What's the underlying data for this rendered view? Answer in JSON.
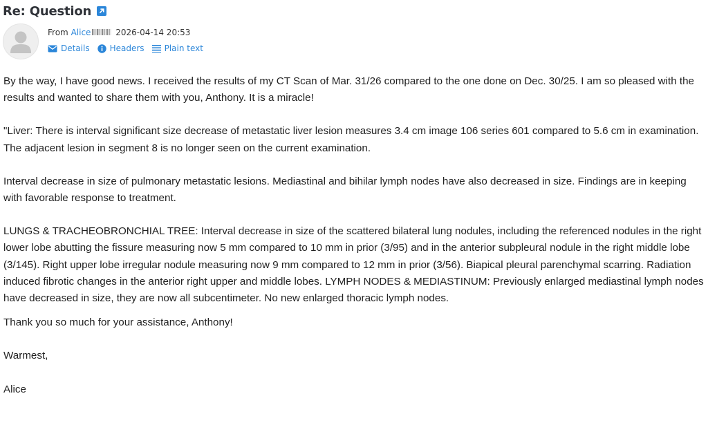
{
  "message": {
    "subject": "Re: Question",
    "from_label": "From",
    "sender_name": "Alice",
    "date": "2026-04-14 20:53",
    "links": {
      "details": "Details",
      "headers": "Headers",
      "plain_text": "Plain text"
    }
  },
  "body": {
    "paragraphs": [
      "By the way, I have good news. I received the results of my CT Scan of Mar. 31/26 compared to the one done on Dec. 30/25. I am so pleased with the results and wanted to share them with you, Anthony. It is a miracle!",
      "\"Liver: There is interval significant size decrease of metastatic liver lesion measures 3.4 cm image 106 series 601 compared to 5.6 cm in examination. The adjacent lesion in segment 8 is no longer seen on the current examination.",
      "Interval decrease in size of pulmonary metastatic lesions. Mediastinal and bihilar lymph nodes have also decreased in size. Findings are in keeping with favorable response to treatment.",
      "LUNGS & TRACHEOBRONCHIAL TREE: Interval decrease in size of the scattered bilateral lung nodules, including the referenced nodules in the right lower lobe abutting the fissure measuring now 5 mm compared to 10 mm in prior (3/95) and in the anterior subpleural nodule in the right middle lobe (3/145). Right upper lobe irregular nodule measuring now 9 mm compared to 12 mm in prior (3/56). Biapical pleural parenchymal scarring. Radiation induced fibrotic changes in the anterior right upper and middle lobes. LYMPH NODES & MEDIASTINUM: Previously enlarged mediastinal lymph nodes have decreased in size, they are now all subcentimeter. No new enlarged thoracic lymph nodes.",
      "Thank you so much for your assistance, Anthony!",
      "Warmest,",
      "Alice"
    ]
  },
  "colors": {
    "link": "#2b86d9",
    "text": "#222222",
    "subject": "#2f3238"
  },
  "icons": {
    "open": "external-link-icon",
    "details": "envelope-icon",
    "headers": "info-icon",
    "plain_text": "lines-icon",
    "avatar": "person-silhouette-icon"
  }
}
